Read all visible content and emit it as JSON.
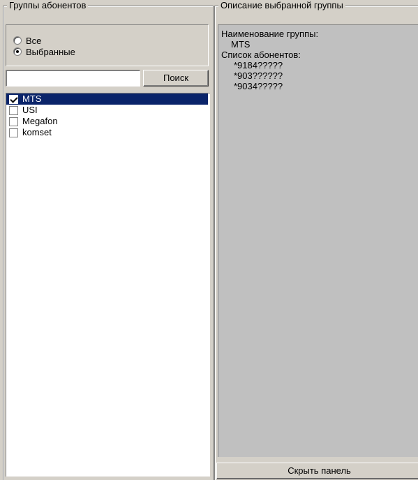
{
  "left_group": {
    "title": "Группы абонентов",
    "radio_all": "Все",
    "radio_selected": "Выбранные",
    "search_value": "",
    "search_button": "Поиск",
    "items": [
      {
        "label": "MTS",
        "checked": true,
        "selected": true
      },
      {
        "label": "USI",
        "checked": false,
        "selected": false
      },
      {
        "label": "Megafon",
        "checked": false,
        "selected": false
      },
      {
        "label": "komset",
        "checked": false,
        "selected": false
      }
    ]
  },
  "right_group": {
    "title": "Описание выбранной группы",
    "name_label": "Наименование группы:",
    "name_value": "MTS",
    "list_label": "Список абонентов:",
    "subscribers": [
      "*9184?????",
      "*903??????",
      "*9034?????"
    ],
    "hide_button": "Скрыть панель"
  },
  "colors": {
    "window_bg": "#d4d0c8",
    "panel_bg": "#c0c0c0",
    "selection_bg": "#0a246a"
  }
}
